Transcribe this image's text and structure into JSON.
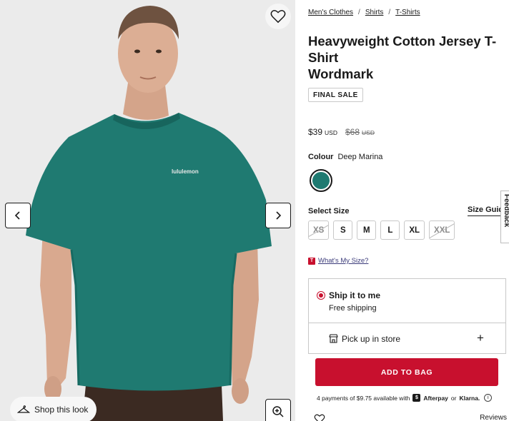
{
  "gallery": {
    "shop_look_label": "Shop this look",
    "shirt_logo_text": "lululemon"
  },
  "breadcrumb": {
    "items": [
      "Men's Clothes",
      "Shirts",
      "T-Shirts"
    ],
    "separator": "/"
  },
  "product": {
    "title_line1": "Heavyweight Cotton Jersey T-Shirt",
    "title_line2": "Wordmark",
    "badge": "FINAL SALE",
    "price": {
      "current": "$39",
      "current_currency": "USD",
      "original": "$68",
      "original_currency": "USD"
    },
    "colour_label": "Colour",
    "colour_name": "Deep Marina",
    "colour_hex": "#1f7a71"
  },
  "sizes": {
    "label": "Select Size",
    "guide_label": "Size Guide",
    "options": [
      {
        "label": "XS",
        "available": false
      },
      {
        "label": "S",
        "available": true
      },
      {
        "label": "M",
        "available": true
      },
      {
        "label": "L",
        "available": true
      },
      {
        "label": "XL",
        "available": true
      },
      {
        "label": "XXL",
        "available": false
      }
    ]
  },
  "whats_my_size": {
    "icon_letter": "T",
    "label": "What's My Size?"
  },
  "feedback_label": "Feedback",
  "shipping": {
    "ship_title": "Ship it to me",
    "ship_sub": "Free shipping",
    "pickup_label": "Pick up in store",
    "expand_symbol": "+"
  },
  "cta": {
    "add_to_bag": "ADD TO BAG"
  },
  "installments": {
    "text": "4 payments of $9.75 available with",
    "afterpay": "Afterpay",
    "or": "or",
    "klarna": "Klarna."
  },
  "bottom": {
    "reviews_label": "Reviews"
  },
  "colors": {
    "accent": "#c8102e",
    "text": "#1a1a1a",
    "shirt": "#1f7a71"
  }
}
